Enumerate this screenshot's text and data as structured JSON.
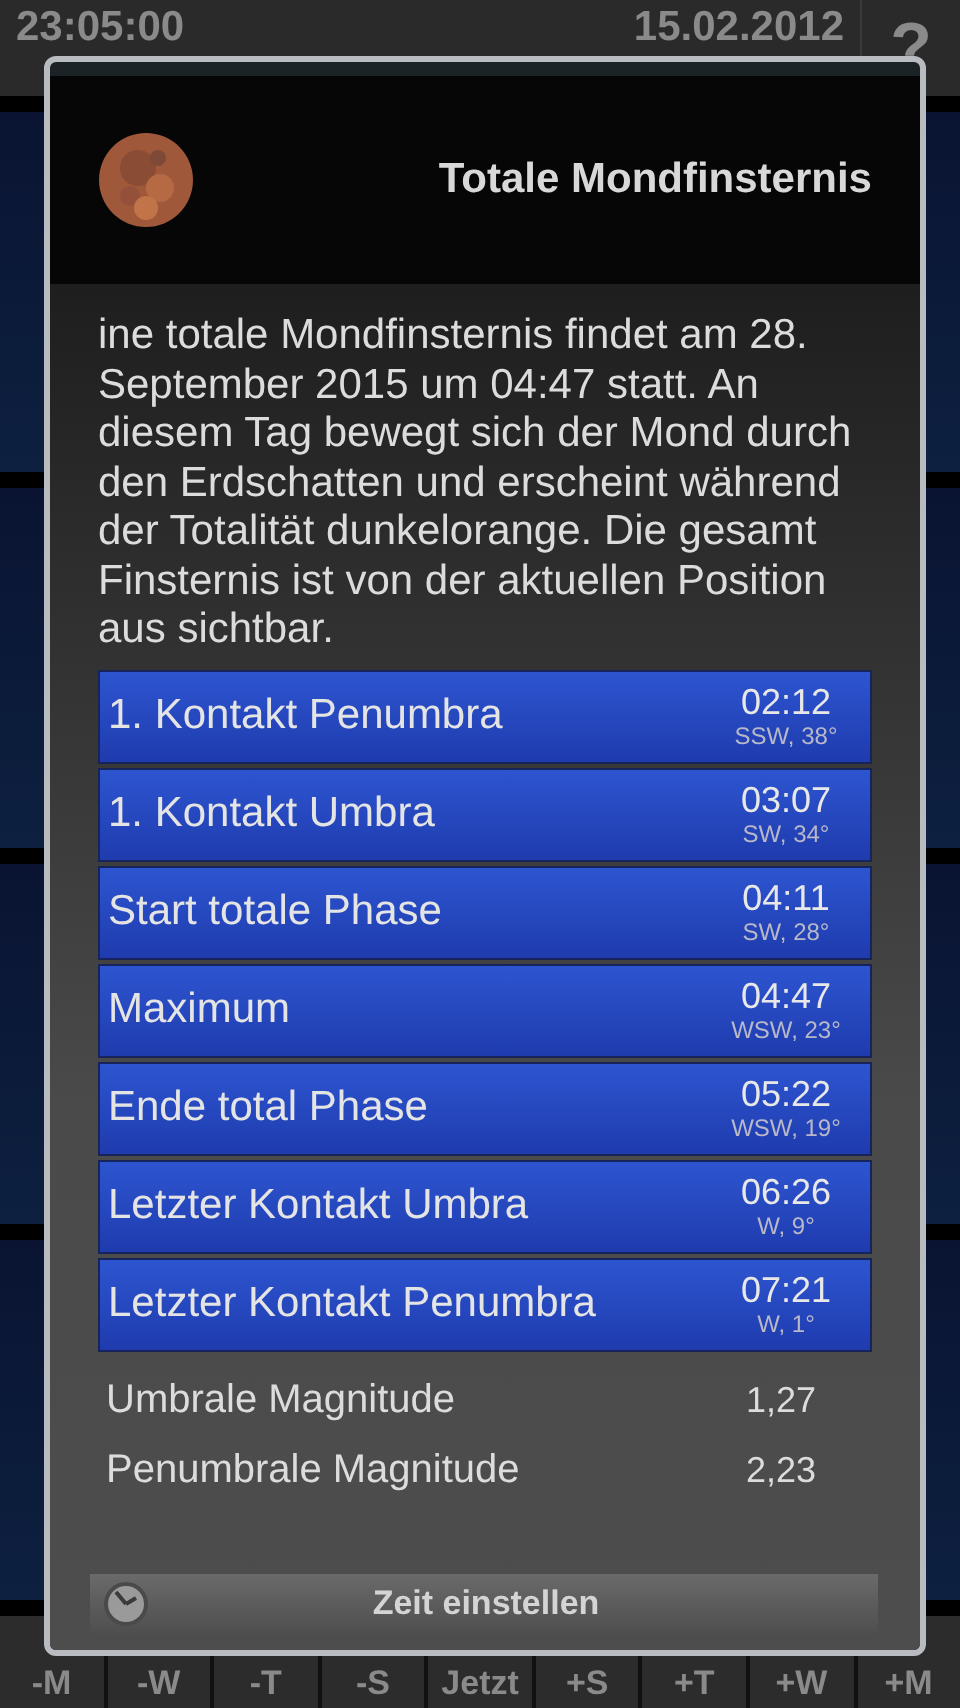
{
  "dialog": {
    "title": "Totale Mondfinsternis",
    "description": "ine totale Mondfinsternis findet am 28. September 2015 um 04:47 statt. An diesem Tag bewegt sich der Mond durch den Erdschatten und erscheint während der Totalität dunkelorange. Die gesamt Finsternis ist von der aktuellen Position aus sichtbar.",
    "events": [
      {
        "name": "1. Kontakt Penumbra",
        "time": "02:12",
        "position": "SSW, 38°"
      },
      {
        "name": "1. Kontakt Umbra",
        "time": "03:07",
        "position": "SW, 34°"
      },
      {
        "name": "Start totale Phase",
        "time": "04:11",
        "position": "SW, 28°"
      },
      {
        "name": "Maximum",
        "time": "04:47",
        "position": "WSW, 23°"
      },
      {
        "name": "Ende total Phase",
        "time": "05:22",
        "position": "WSW, 19°"
      },
      {
        "name": "Letzter Kontakt Umbra",
        "time": "06:26",
        "position": "W, 9°"
      },
      {
        "name": "Letzter Kontakt Penumbra",
        "time": "07:21",
        "position": "W, 1°"
      }
    ],
    "magnitudes": [
      {
        "label": "Umbrale Magnitude",
        "value": "1,27"
      },
      {
        "label": "Penumbrale Magnitude",
        "value": "2,23"
      }
    ],
    "button": "Zeit einstellen"
  },
  "status_bar": {
    "time": "23:05:00",
    "date": "15.02.2012",
    "help": "?"
  },
  "time_buttons": [
    "-M",
    "-W",
    "-T",
    "-S",
    "Jetzt",
    "+S",
    "+T",
    "+W",
    "+M"
  ]
}
